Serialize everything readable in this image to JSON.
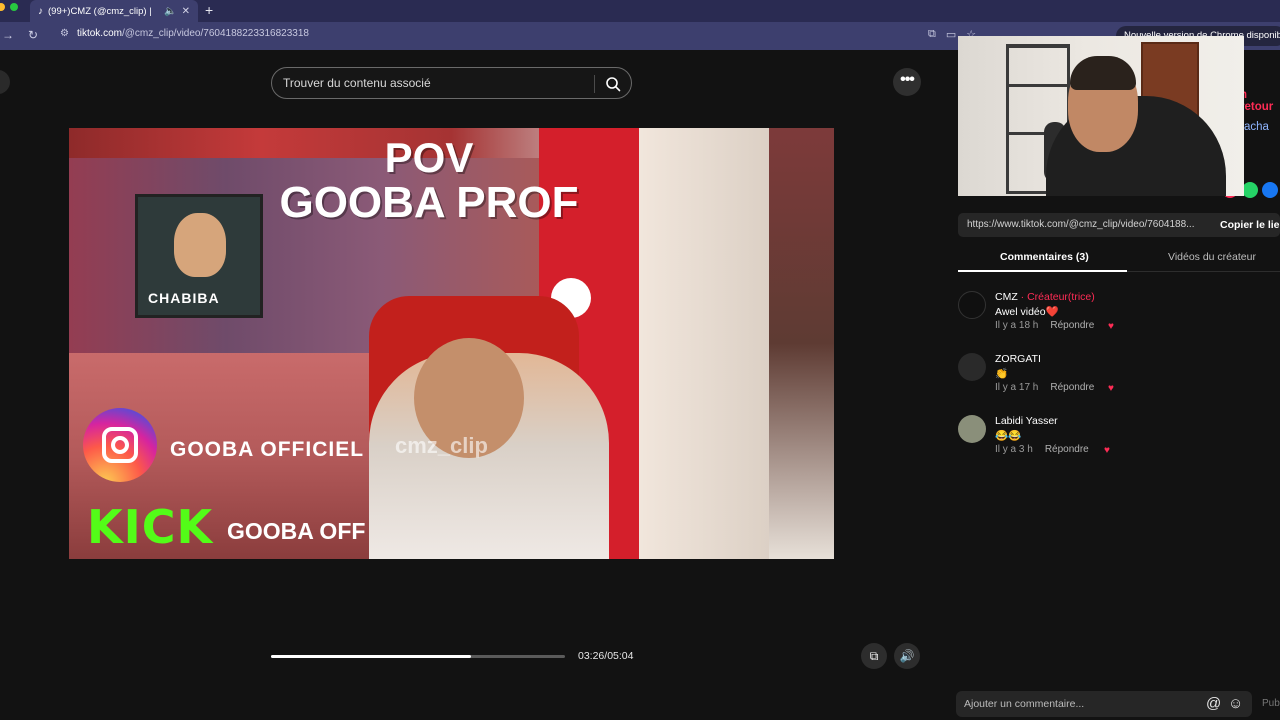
{
  "browser": {
    "tab_title": "(99+)CMZ (@cmz_clip) |",
    "tab_icon": "tiktok-icon",
    "url_domain": "tiktok.com",
    "url_path": "/@cmz_clip/video/7604188223316823318",
    "update_notice": "Nouvelle version de Chrome disponible"
  },
  "search": {
    "placeholder": "Trouver du contenu associé"
  },
  "video": {
    "title_line1": "POV",
    "title_line2": "GOOBA PROF",
    "poster_caption": "CHABIBA",
    "instagram_text": "GOOBA  OFFICIEL",
    "watermark": "cmz_clip",
    "kick_logo": "KICK",
    "kick_text": "GOOBA OFF",
    "progress": 0.68,
    "timecode": "03:26/05:04"
  },
  "side_partial": {
    "retour": "n retour",
    "recacha": "acha"
  },
  "share": {
    "link": "https://www.tiktok.com/@cmz_clip/video/7604188...",
    "copy_label": "Copier le lien"
  },
  "tabs": {
    "comments": "Commentaires (3)",
    "creator_videos": "Vidéos du créateur"
  },
  "comments": [
    {
      "author": "CMZ",
      "creator_badge": " · Créateur(trice)",
      "text": "Awel vidéo❤️",
      "time": "Il y a 18 h",
      "reply": "Répondre",
      "avatar_color": "#101010"
    },
    {
      "author": "ZORGATI",
      "creator_badge": "",
      "text": "👏",
      "time": "Il y a 17 h",
      "reply": "Répondre",
      "avatar_color": "#2a2a2a"
    },
    {
      "author": "Labidi Yasser",
      "creator_badge": "",
      "text": "😂😂",
      "time": "Il y a 3 h",
      "reply": "Répondre",
      "avatar_color": "#8a8f7a"
    }
  ],
  "comment_bar": {
    "placeholder": "Ajouter un commentaire...",
    "publish": "Pub"
  },
  "colors": {
    "accent": "#fe2c55",
    "kick_green": "#53fc18"
  }
}
